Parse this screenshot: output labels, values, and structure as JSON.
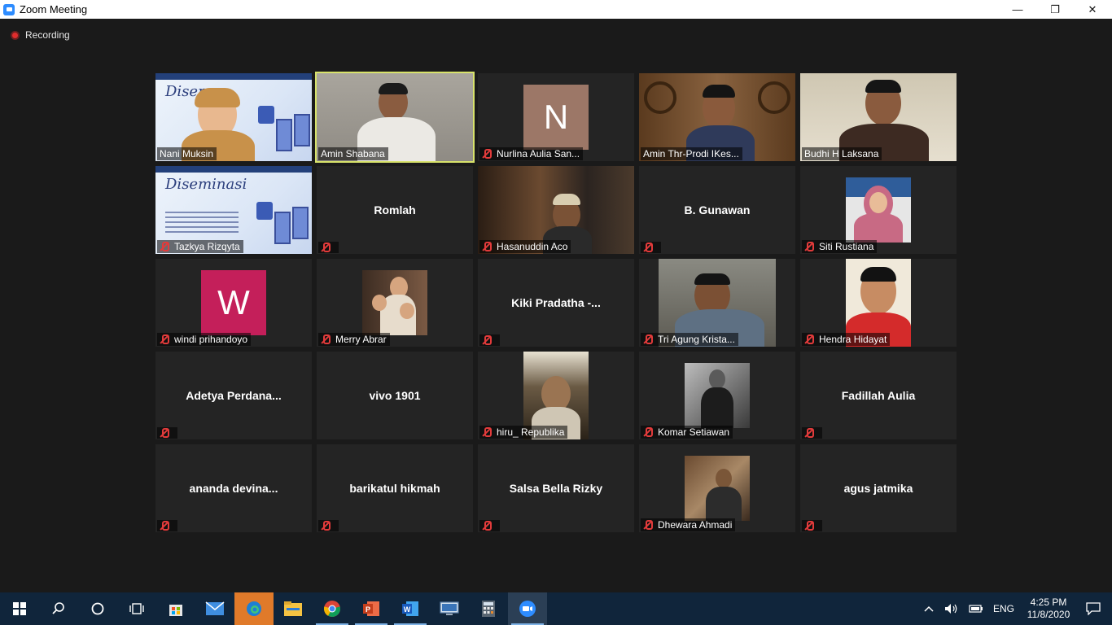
{
  "window": {
    "title": "Zoom Meeting",
    "minimize_glyph": "—",
    "restore_glyph": "❐",
    "close_glyph": "✕"
  },
  "recording": {
    "label": "Recording"
  },
  "participants": [
    {
      "name": "Nani Muksin",
      "display": "Nani Muksin",
      "muted": false,
      "kind": "slide-video"
    },
    {
      "name": "Amin Shabana",
      "display": "Amin Shabana",
      "muted": false,
      "kind": "video",
      "active_speaker": true
    },
    {
      "name": "Nurlina Aulia San...",
      "display": "Nurlina Aulia San...",
      "muted": true,
      "kind": "avatar",
      "avatar_letter": "N",
      "avatar_color": "#9c7767"
    },
    {
      "name": "Amin Thr-Prodi IKes...",
      "display": "Amin Thr-Prodi IKes...",
      "muted": false,
      "kind": "video"
    },
    {
      "name": "Budhi H Laksana",
      "display": "Budhi H Laksana",
      "muted": false,
      "kind": "video"
    },
    {
      "name": "Tazkya Rizqyta",
      "display": "Tazkya Rizqyta",
      "muted": true,
      "kind": "slide"
    },
    {
      "name": "Romlah",
      "display": "Romlah",
      "muted": true,
      "kind": "name"
    },
    {
      "name": "Hasanuddin Aco",
      "display": "Hasanuddin Aco",
      "muted": true,
      "kind": "video"
    },
    {
      "name": "B. Gunawan",
      "display": "B. Gunawan",
      "muted": true,
      "kind": "name"
    },
    {
      "name": "Siti Rustiana",
      "display": "Siti Rustiana",
      "muted": true,
      "kind": "photo"
    },
    {
      "name": "windi prihandoyo",
      "display": "windi prihandoyo",
      "muted": true,
      "kind": "avatar",
      "avatar_letter": "W",
      "avatar_color": "#c41f5a"
    },
    {
      "name": "Merry Abrar",
      "display": "Merry Abrar",
      "muted": true,
      "kind": "photo"
    },
    {
      "name": "Kiki  Pradatha  -...",
      "display": "Kiki  Pradatha  -...",
      "muted": true,
      "kind": "name"
    },
    {
      "name": "Tri Agung Krista...",
      "display": "Tri Agung Krista...",
      "muted": true,
      "kind": "video"
    },
    {
      "name": "Hendra Hidayat",
      "display": "Hendra Hidayat",
      "muted": true,
      "kind": "photo"
    },
    {
      "name": "Adetya  Perdana...",
      "display": "Adetya  Perdana...",
      "muted": true,
      "kind": "name"
    },
    {
      "name": "vivo 1901",
      "display": "vivo 1901",
      "muted": false,
      "kind": "name"
    },
    {
      "name": "hiru_ Republika",
      "display": "hiru_ Republika",
      "muted": true,
      "kind": "video"
    },
    {
      "name": "Komar Setiawan",
      "display": "Komar Setiawan",
      "muted": true,
      "kind": "photo"
    },
    {
      "name": "Fadillah Aulia",
      "display": "Fadillah Aulia",
      "muted": true,
      "kind": "name"
    },
    {
      "name": "ananda  devina...",
      "display": "ananda  devina...",
      "muted": true,
      "kind": "name"
    },
    {
      "name": "barikatul hikmah",
      "display": "barikatul hikmah",
      "muted": true,
      "kind": "name"
    },
    {
      "name": "Salsa Bella Rizky",
      "display": "Salsa Bella Rizky",
      "muted": true,
      "kind": "name"
    },
    {
      "name": "Dhewara Ahmadi",
      "display": "Dhewara Ahmadi",
      "muted": true,
      "kind": "photo"
    },
    {
      "name": "agus jatmika",
      "display": "agus jatmika",
      "muted": true,
      "kind": "name"
    }
  ],
  "slide": {
    "heading": "Disem",
    "full_heading": "Diseminasi"
  },
  "taskbar": {
    "apps": [
      {
        "id": "start",
        "icon": "windows-start-icon"
      },
      {
        "id": "search",
        "icon": "search-icon"
      },
      {
        "id": "cortana",
        "icon": "cortana-icon"
      },
      {
        "id": "taskview",
        "icon": "task-view-icon"
      },
      {
        "id": "store",
        "icon": "store-icon"
      },
      {
        "id": "mail",
        "icon": "mail-icon"
      },
      {
        "id": "edge",
        "icon": "edge-icon",
        "active": true
      },
      {
        "id": "explorer",
        "icon": "file-explorer-icon"
      },
      {
        "id": "chrome",
        "icon": "chrome-icon",
        "open": true
      },
      {
        "id": "powerpoint",
        "icon": "powerpoint-icon",
        "open": true
      },
      {
        "id": "word",
        "icon": "word-icon",
        "open": true
      },
      {
        "id": "remote",
        "icon": "remote-desktop-icon"
      },
      {
        "id": "calculator",
        "icon": "calculator-icon"
      },
      {
        "id": "zoom",
        "icon": "zoom-icon",
        "open": true
      }
    ],
    "tray": {
      "language": "ENG",
      "time": "4:25 PM",
      "date": "11/8/2020"
    }
  },
  "colors": {
    "meeting_bg": "#1a1a1a",
    "tile_bg": "#242424",
    "active_speaker_border": "#d8e36b",
    "mute_red": "#e23b3b",
    "taskbar_bg": "#10253b",
    "taskbar_active": "#e07a2a",
    "zoom_blue": "#2d8cff"
  }
}
